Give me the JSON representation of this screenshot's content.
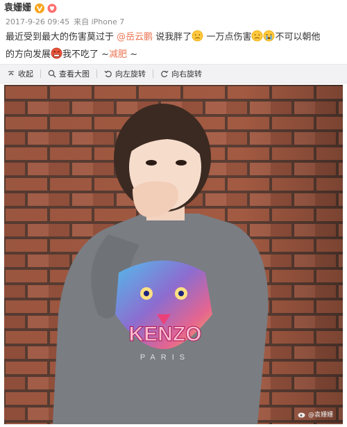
{
  "post": {
    "username": "袁姗姗",
    "meta": {
      "date": "2017-9-26 09:45",
      "source": "来自 iPhone 7"
    },
    "content": {
      "line1_a": "最近受到最大的伤害莫过于",
      "mention": "@岳云鹏",
      "line1_b": " 说我胖了",
      "line1_c": " 一万点伤害",
      "line1_d": "不可以朝他",
      "line2_a": "的方向发展",
      "line2_b": "我不吃了 ~",
      "tag": "减肥",
      "line2_c": " ~"
    }
  },
  "toolbar": {
    "collapse": "收起",
    "view_large": "查看大图",
    "rotate_left": "向左旋转",
    "rotate_right": "向右旋转"
  },
  "photo": {
    "shirt_text": "KENZO",
    "shirt_subtext": "PARIS",
    "watermark": "@袁姗姗"
  },
  "colors": {
    "link": "#eb7350",
    "toolbar_bg": "#f2f2f5",
    "badge": "#f7a51c"
  },
  "icons": [
    "verified-v-icon",
    "heart-badge-icon",
    "collapse-icon",
    "magnify-icon",
    "rotate-left-icon",
    "rotate-right-icon",
    "weibo-logo-icon"
  ]
}
